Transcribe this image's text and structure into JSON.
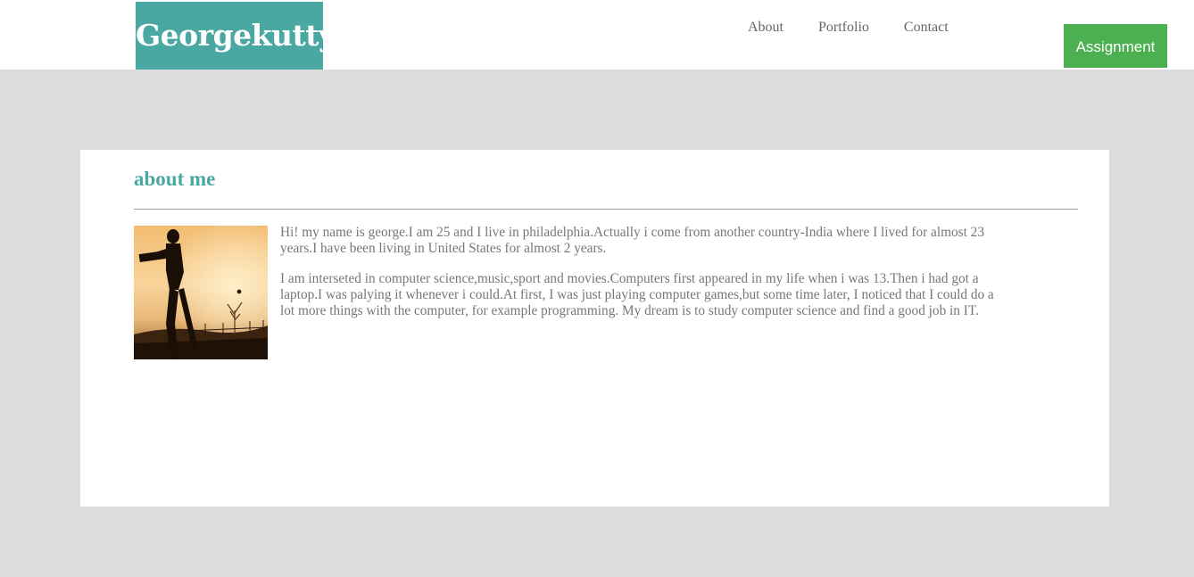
{
  "header": {
    "logo_text": "Georgekutty",
    "nav": [
      {
        "label": "About"
      },
      {
        "label": "Portfolio"
      },
      {
        "label": "Contact"
      }
    ],
    "cta_label": "Assignment"
  },
  "about": {
    "title": "about me",
    "photo": "cricket-player-silhouette-sunset-photo",
    "paragraphs": [
      "Hi! my name is george.I am 25 and I live in philadelphia.Actually i come from another country-India where I lived for almost 23 years.I have been living in United States for almost 2 years.",
      "I am interseted in computer science,music,sport and movies.Computers first appeared in my life when i was 13.Then i had got a laptop.I was palying it whenever i could.At first, I was just playing computer games,but some time later, I noticed that I could do a lot more things with the computer, for example programming. My dream is to study computer science and find a good job in IT."
    ]
  },
  "colors": {
    "accent": "#4aa8a3",
    "cta": "#4caf50",
    "page_bg": "#dcdcdc",
    "text": "#777777"
  }
}
